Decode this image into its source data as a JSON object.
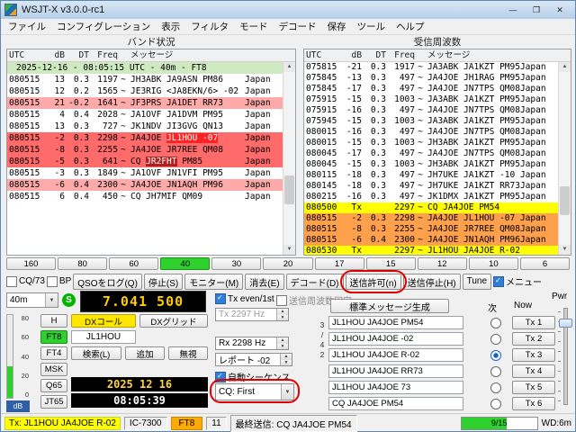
{
  "window": {
    "title": "WSJT-X   v3.0.0-rc1",
    "min": "—",
    "max": "❐",
    "close": "✕"
  },
  "menu": {
    "items": [
      "ファイル",
      "コンフィグレーション",
      "表示",
      "フィルタ",
      "モード",
      "デコード",
      "保存",
      "ツール",
      "ヘルプ"
    ]
  },
  "band_activity": {
    "title": "バンド状況",
    "headers": {
      "utc": "UTC",
      "db": "dB",
      "dt": "DT",
      "freq": "Freq",
      "msg": "メッセージ"
    },
    "rows": [
      {
        "sep": true,
        "text": "2025-12-16 - 08:05:15 UTC - 40m - FT8"
      },
      {
        "utc": "080515",
        "db": "13",
        "dt": "0.3",
        "freq": "1197",
        "mode": "~",
        "parts": [
          {
            "t": "JH3ABK JA9ASN PM86"
          }
        ],
        "country": "Japan",
        "hl": "none"
      },
      {
        "utc": "080515",
        "db": "12",
        "dt": "0.2",
        "freq": "1565",
        "mode": "~",
        "parts": [
          {
            "t": "JE3RIG <JA8EKN/6> -02"
          }
        ],
        "country": "Japan",
        "hl": "none"
      },
      {
        "utc": "080515",
        "db": "21",
        "dt": "-0.2",
        "freq": "1641",
        "mode": "~",
        "parts": [
          {
            "t": "JF3PRS JA1DET RR73"
          }
        ],
        "country": "Japan",
        "hl": "pink"
      },
      {
        "utc": "080515",
        "db": "4",
        "dt": "0.4",
        "freq": "2028",
        "mode": "~",
        "parts": [
          {
            "t": "JA1OVF JA1DVM PM95"
          }
        ],
        "country": "Japan",
        "hl": "none"
      },
      {
        "utc": "080515",
        "db": "13",
        "dt": "0.3",
        "freq": "727",
        "mode": "~",
        "parts": [
          {
            "t": "JK1NDV JI3GVG QN13"
          }
        ],
        "country": "Japan",
        "hl": "none"
      },
      {
        "utc": "080515",
        "db": "-2",
        "dt": "0.3",
        "freq": "2298",
        "mode": "~",
        "parts": [
          {
            "t": "JA4JOE "
          },
          {
            "t": "JL1HOU -07",
            "hl": "chip-bright"
          }
        ],
        "country": "Japan",
        "hl": "red"
      },
      {
        "utc": "080515",
        "db": "-8",
        "dt": "0.3",
        "freq": "2255",
        "mode": "~",
        "parts": [
          {
            "t": "JA4JOE JR7REE QM08"
          }
        ],
        "country": "Japan",
        "hl": "red"
      },
      {
        "utc": "080515",
        "db": "-5",
        "dt": "0.3",
        "freq": "641",
        "mode": "~",
        "parts": [
          {
            "t": "CQ "
          },
          {
            "t": "JR2FHT",
            "hl": "chip-dark"
          },
          {
            "t": " PM85"
          }
        ],
        "country": "Japan",
        "hl": "red"
      },
      {
        "utc": "080515",
        "db": "-3",
        "dt": "0.3",
        "freq": "1849",
        "mode": "~",
        "parts": [
          {
            "t": "JA1OVF JN1VFI PM95"
          }
        ],
        "country": "Japan",
        "hl": "none"
      },
      {
        "utc": "080515",
        "db": "-6",
        "dt": "0.4",
        "freq": "2300",
        "mode": "~",
        "parts": [
          {
            "t": "JA4JOE JN1AQH PM96"
          }
        ],
        "country": "Japan",
        "hl": "pink"
      },
      {
        "utc": "080515",
        "db": "6",
        "dt": "0.4",
        "freq": "450",
        "mode": "~",
        "parts": [
          {
            "t": "CQ JH7MIF QM09"
          }
        ],
        "country": "Japan",
        "hl": "none"
      }
    ]
  },
  "rx_frequency": {
    "title": "受信周波数",
    "headers": {
      "utc": "UTC",
      "db": "dB",
      "dt": "DT",
      "freq": "Freq",
      "msg": "メッセージ"
    },
    "rows": [
      {
        "utc": "075815",
        "db": "-21",
        "dt": "0.3",
        "freq": "1917",
        "mode": "~",
        "parts": [
          {
            "t": "JA3ABK JA1KZT PM95"
          }
        ],
        "country": "Japan",
        "hl": "none"
      },
      {
        "utc": "075845",
        "db": "-13",
        "dt": "0.3",
        "freq": "497",
        "mode": "~",
        "parts": [
          {
            "t": "JA4JOE JH1RAG PM95"
          }
        ],
        "country": "Japan",
        "hl": "none"
      },
      {
        "utc": "075845",
        "db": "-17",
        "dt": "0.3",
        "freq": "497",
        "mode": "~",
        "parts": [
          {
            "t": "JA4JOE JN7TPS QM08"
          }
        ],
        "country": "Japan",
        "hl": "none"
      },
      {
        "utc": "075915",
        "db": "-15",
        "dt": "0.3",
        "freq": "1003",
        "mode": "~",
        "parts": [
          {
            "t": "JA3ABK JA1KZT PM95"
          }
        ],
        "country": "Japan",
        "hl": "none"
      },
      {
        "utc": "075915",
        "db": "-16",
        "dt": "0.3",
        "freq": "497",
        "mode": "~",
        "parts": [
          {
            "t": "JA4JOE JN7TPS QM08"
          }
        ],
        "country": "Japan",
        "hl": "none"
      },
      {
        "utc": "075945",
        "db": "-15",
        "dt": "0.3",
        "freq": "1003",
        "mode": "~",
        "parts": [
          {
            "t": "JA3ABK JA1KZT PM95"
          }
        ],
        "country": "Japan",
        "hl": "none"
      },
      {
        "utc": "080015",
        "db": "-16",
        "dt": "0.3",
        "freq": "497",
        "mode": "~",
        "parts": [
          {
            "t": "JA4JOE JN7TPS QM08"
          }
        ],
        "country": "Japan",
        "hl": "none"
      },
      {
        "utc": "080015",
        "db": "-15",
        "dt": "0.3",
        "freq": "1003",
        "mode": "~",
        "parts": [
          {
            "t": "JH3ABK JA1KZT PM95"
          }
        ],
        "country": "Japan",
        "hl": "none"
      },
      {
        "utc": "080045",
        "db": "-17",
        "dt": "0.3",
        "freq": "497",
        "mode": "~",
        "parts": [
          {
            "t": "JA4JOE JN7TPS QM08"
          }
        ],
        "country": "Japan",
        "hl": "none"
      },
      {
        "utc": "080045",
        "db": "-15",
        "dt": "0.3",
        "freq": "1003",
        "mode": "~",
        "parts": [
          {
            "t": "JH3ABK JA1KZT PM95"
          }
        ],
        "country": "Japan",
        "hl": "none"
      },
      {
        "utc": "080115",
        "db": "-18",
        "dt": "0.3",
        "freq": "497",
        "mode": "~",
        "parts": [
          {
            "t": "JH7UKE JA1KZT -10"
          }
        ],
        "country": "Japan",
        "hl": "none"
      },
      {
        "utc": "080145",
        "db": "-18",
        "dt": "0.3",
        "freq": "497",
        "mode": "~",
        "parts": [
          {
            "t": "JH7UKE JA1KZT RR73"
          }
        ],
        "country": "Japan",
        "hl": "none"
      },
      {
        "utc": "080215",
        "db": "-16",
        "dt": "0.3",
        "freq": "497",
        "mode": "~",
        "parts": [
          {
            "t": "JK1DMX JA1KZT PM95"
          }
        ],
        "country": "Japan",
        "hl": "none"
      },
      {
        "utc": "080500",
        "db": "Tx",
        "dt": "",
        "freq": "2297",
        "mode": "~",
        "parts": [
          {
            "t": "CQ JA4JOE PM54"
          }
        ],
        "country": "",
        "hl": "yellow"
      },
      {
        "utc": "080515",
        "db": "-2",
        "dt": "0.3",
        "freq": "2298",
        "mode": "~",
        "parts": [
          {
            "t": "JA4JOE JL1HOU -07"
          }
        ],
        "country": "Japan",
        "hl": "orange"
      },
      {
        "utc": "080515",
        "db": "-8",
        "dt": "0.3",
        "freq": "2255",
        "mode": "~",
        "parts": [
          {
            "t": "JA4JOE JR7REE QM08"
          }
        ],
        "country": "Japan",
        "hl": "orange"
      },
      {
        "utc": "080515",
        "db": "-6",
        "dt": "0.4",
        "freq": "2300",
        "mode": "~",
        "parts": [
          {
            "t": "JA4JOE JN1AQH PM96"
          }
        ],
        "country": "Japan",
        "hl": "orange"
      },
      {
        "utc": "080530",
        "db": "Tx",
        "dt": "",
        "freq": "2297",
        "mode": "~",
        "parts": [
          {
            "t": "JL1HOU JA4JOE R-02"
          }
        ],
        "country": "",
        "hl": "yellow"
      }
    ]
  },
  "bands": {
    "labels": [
      "160",
      "80",
      "60",
      "40",
      "30",
      "20",
      "17",
      "15",
      "12",
      "10",
      "6"
    ],
    "active": 3
  },
  "controls": {
    "cq73": "CQ/73",
    "bp": "BP",
    "log": "QSOをログ(Q)",
    "stop": "停止(S)",
    "monitor": "モニター(M)",
    "erase": "消去(E)",
    "decode": "デコード(D)",
    "enable_tx": "送信許可(n)",
    "halt_tx": "送信停止(H)",
    "tune": "Tune",
    "menus": "メニュー"
  },
  "station": {
    "band": "40m",
    "s": "S",
    "freq": "7.041 500",
    "dx_call_btn": "DXコール",
    "dx_grid_btn": "DXグリッド",
    "dx_call": "JL1HOU",
    "search": "検索(L)",
    "add": "追加",
    "ignore": "無視",
    "modes": [
      "H",
      "FT8",
      "FT4",
      "MSK",
      "Q65",
      "JT65"
    ],
    "active_mode": "FT8",
    "date": "2025 12 16",
    "time": "08:05:39"
  },
  "txcfg": {
    "tx_even": "Tx even/1st",
    "hold_freq": "送信周波数固定",
    "tx_offset": "Tx 2297 Hz",
    "rx_offset": "Rx 2298 Hz",
    "report": "レポート  -02",
    "auto_seq": "自動シーケンス",
    "cq_mode": "CQ: First"
  },
  "messages": {
    "generate": "標準メッセージ生成",
    "next_hdr": "次",
    "now_hdr": "Now",
    "side_tab": "3/42",
    "pwr": "Pwr",
    "selected": 2,
    "rows": [
      {
        "text": "JL1HOU JA4JOE PM54",
        "button": "Tx 1"
      },
      {
        "text": "JL1HOU JA4JOE -02",
        "button": "Tx 2"
      },
      {
        "text": "JL1HOU JA4JOE R-02",
        "button": "Tx 3"
      },
      {
        "text": "JL1HOU JA4JOE RR73",
        "button": "Tx 4"
      },
      {
        "text": "JL1HOU JA4JOE 73",
        "button": "Tx 5"
      },
      {
        "text": "CQ JA4JOE PM54",
        "button": "Tx 6"
      }
    ]
  },
  "meter": {
    "ticks": [
      "80",
      "60",
      "40",
      "20",
      "0"
    ],
    "readout": "dB",
    "level_pct": 38
  },
  "status": {
    "tx": "Tx: JL1HOU JA4JOE R-02",
    "rig": "IC-7300",
    "mode": "FT8",
    "depth": "11",
    "last": "最終送信: CQ JA4JOE PM54",
    "progress": "9/15",
    "wd": "WD:6m"
  },
  "colors": {
    "active_band": "#2fd12f",
    "mode_active": "#2fd12f",
    "dx_call_bg": "#ffe600",
    "tx_row": "#ffff00",
    "rx_row_red": "#ff6a6a",
    "rx_row_pink": "#ffaaaa",
    "rx_row_orange": "#ffa04d",
    "chip_bright": "#ff2222",
    "chip_dark": "#aa2222",
    "freq_digits": "#ffcc00",
    "date_digits": "#ffd24a",
    "time_digits": "#ffffff",
    "annotation": "#dd0000"
  }
}
